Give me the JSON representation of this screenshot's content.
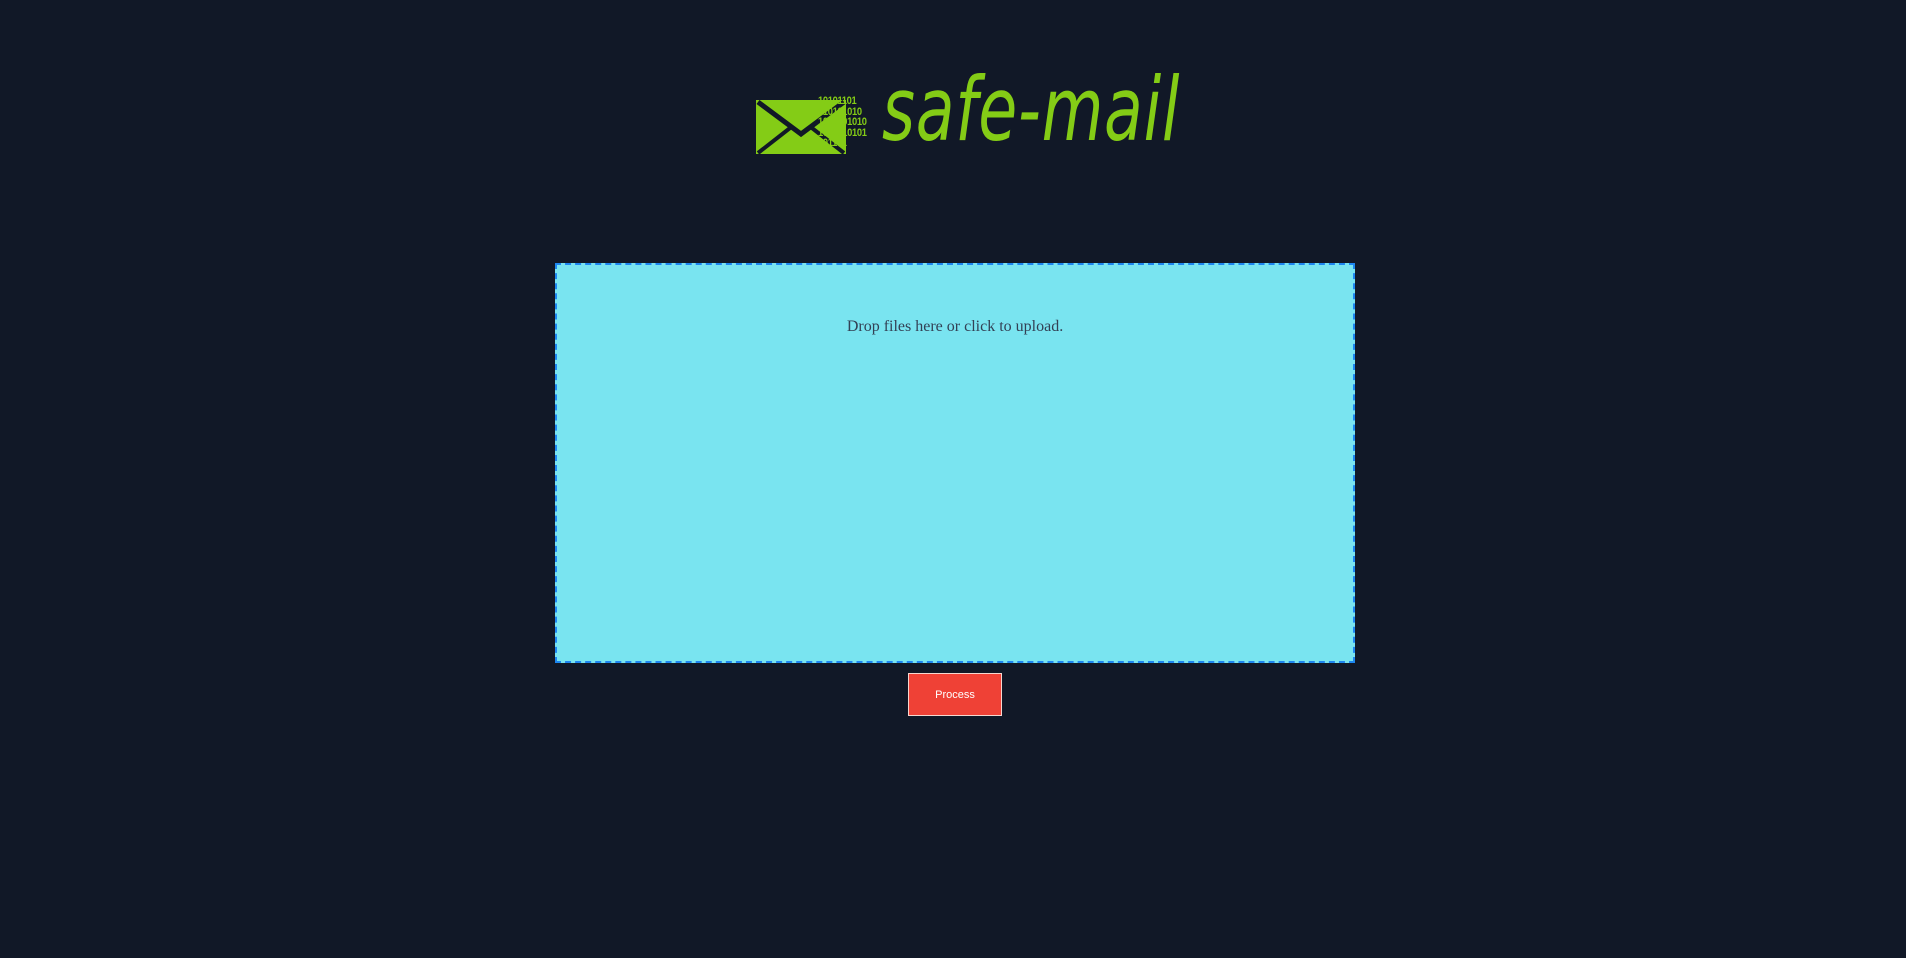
{
  "colors": {
    "background": "#111827",
    "brand_green": "#84cc16",
    "dropzone_fill": "#79e4f0",
    "dropzone_border": "#1d86f0",
    "button_red": "#ef4136"
  },
  "logo": {
    "icon": "envelope-icon",
    "binary_lines": [
      "10101101",
      "010101010",
      "1010101010",
      "1001010101",
      "101101"
    ],
    "text": "safe-mail"
  },
  "dropzone": {
    "message": "Drop files here or click to upload."
  },
  "actions": {
    "process_label": "Process"
  }
}
